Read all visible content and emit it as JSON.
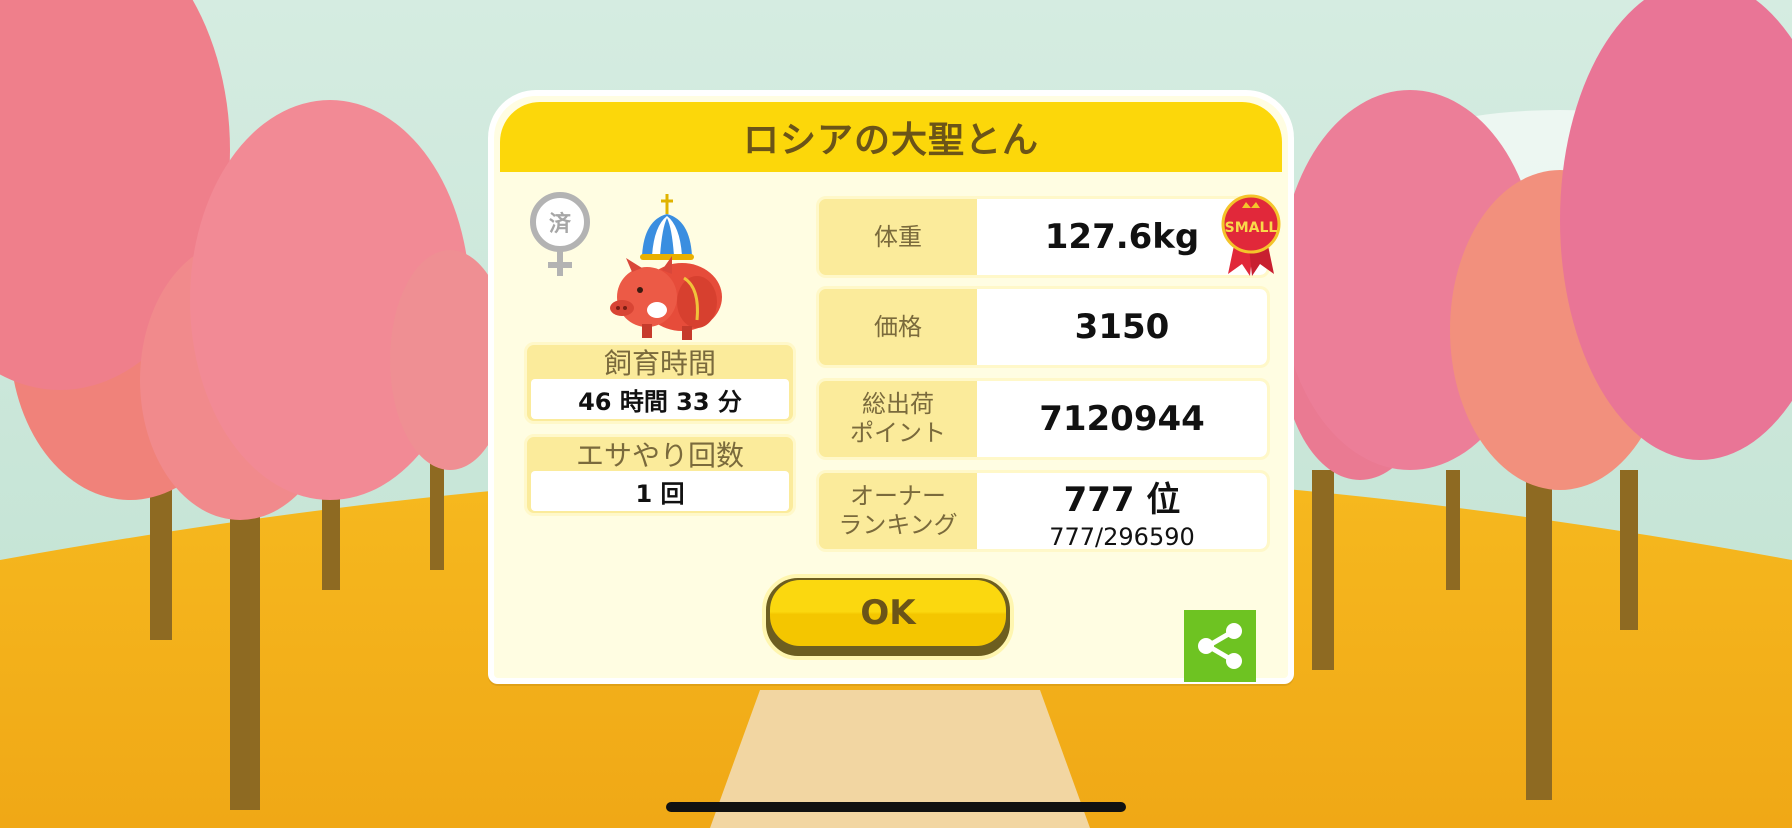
{
  "dialog": {
    "title": "ロシアの大聖とん",
    "seal_label": "済",
    "ribbon_label": "SMALL",
    "raising_time": {
      "label": "飼育時間",
      "value": "46 時間 33 分"
    },
    "feed_count": {
      "label": "エサやり回数",
      "value": "1 回"
    },
    "stats": [
      {
        "label": "体重",
        "value": "127.6kg",
        "sub": ""
      },
      {
        "label": "価格",
        "value": "3150",
        "sub": ""
      },
      {
        "label": "総出荷\nポイント",
        "value": "7120944",
        "sub": ""
      },
      {
        "label": "オーナー\nランキング",
        "value": "777 位",
        "sub": "777/296590"
      }
    ],
    "ok_label": "OK",
    "share_icon": "share-icon"
  },
  "colors": {
    "title_bar": "#fcd70a",
    "panel": "#fffde2",
    "label_box": "#fbeb9b",
    "share_button": "#6ec322",
    "ground": "#f2b21b"
  }
}
